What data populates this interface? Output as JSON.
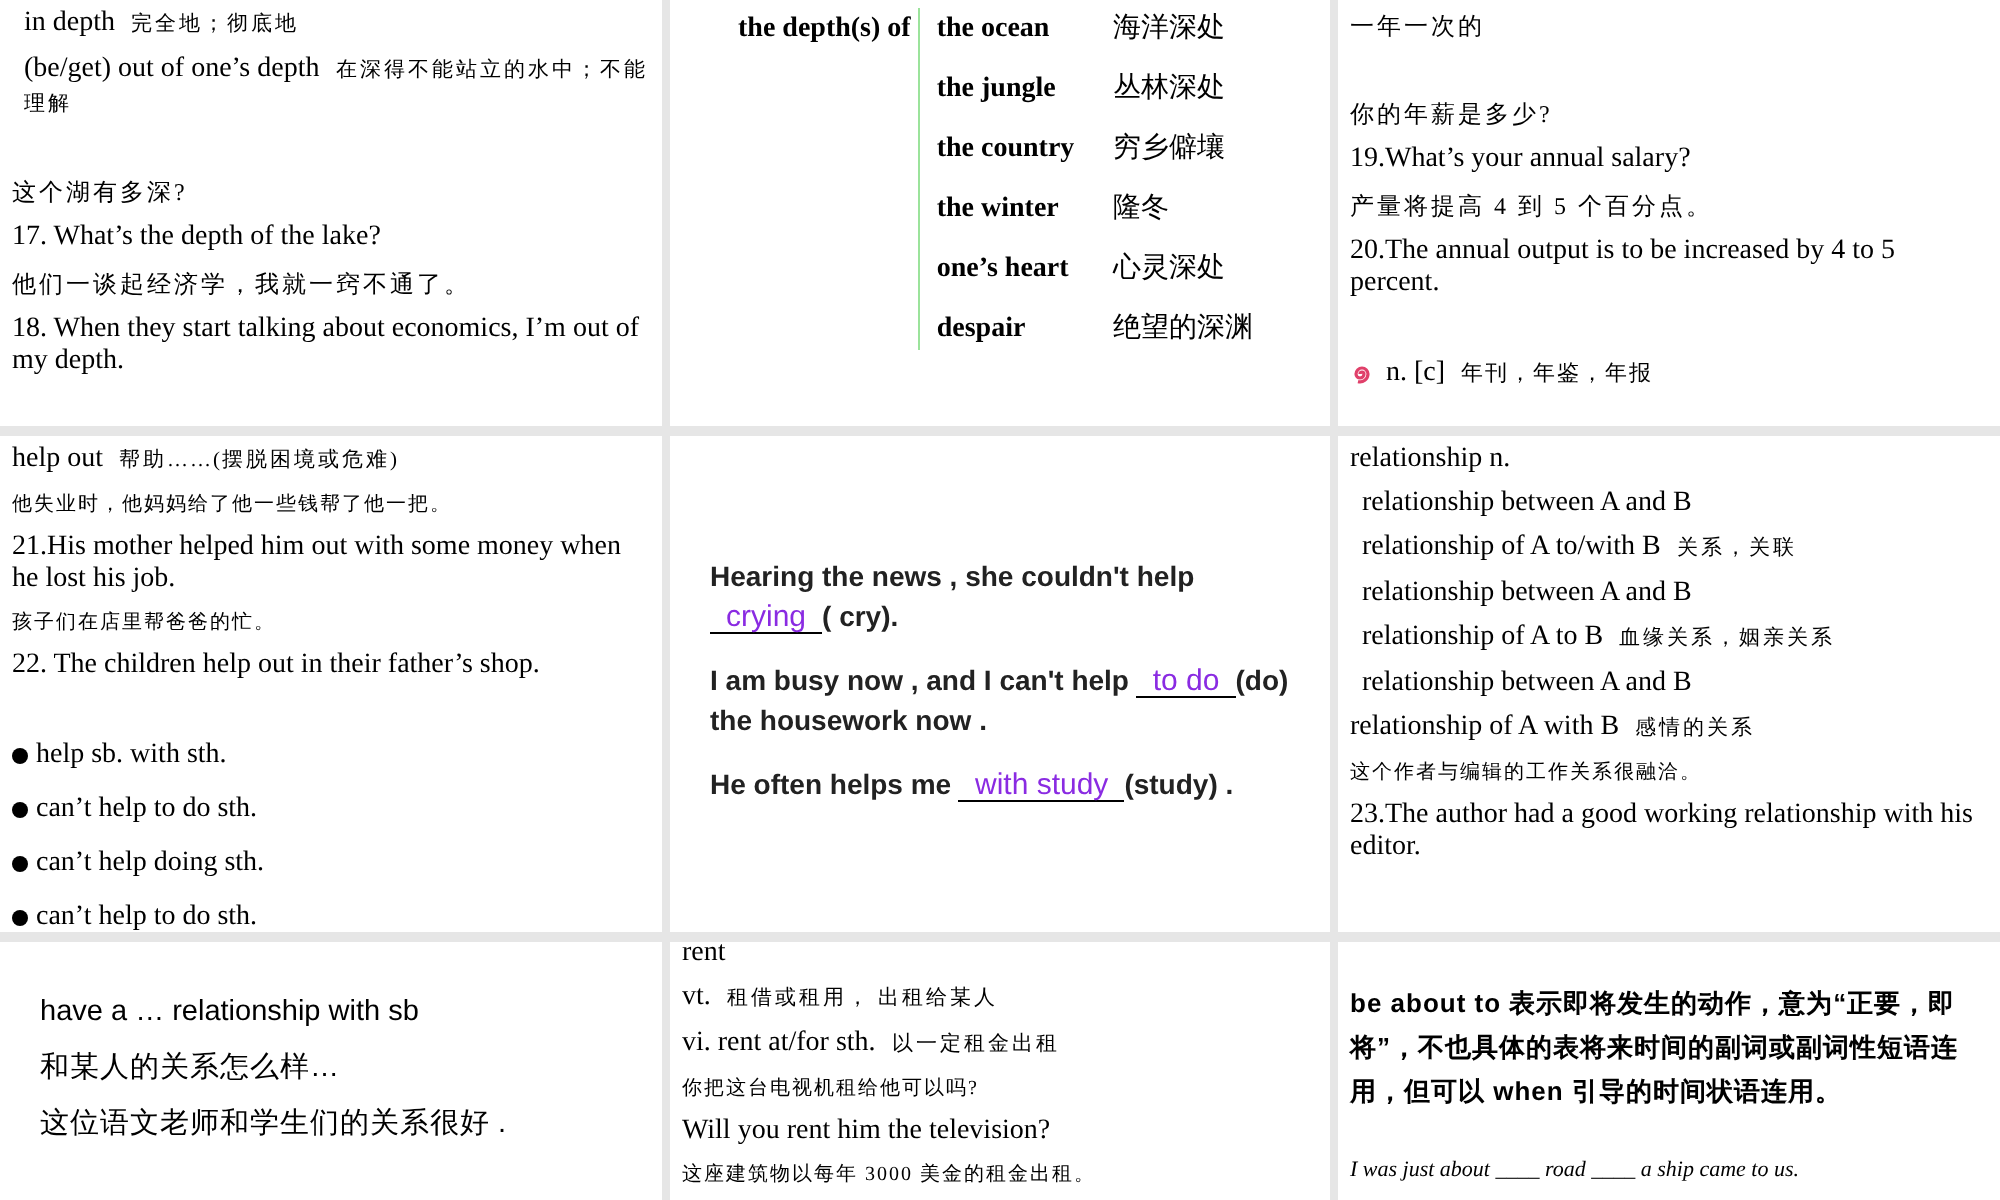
{
  "slides": [
    {
      "kind": "text",
      "lines": [
        {
          "kind": "en",
          "text": "in depth",
          "zh": "完全地；彻底地",
          "indent": true
        },
        {
          "kind": "en",
          "text": "(be/get) out of one’s depth",
          "zh": "在深得不能站立的水中；不能理解",
          "indent": true
        },
        {
          "kind": "zh",
          "text": "这个湖有多深?",
          "gap": true
        },
        {
          "kind": "en",
          "text": "17. What’s the depth of the lake?"
        },
        {
          "kind": "zh",
          "text": "他们一谈起经济学，我就一窍不通了。"
        },
        {
          "kind": "en",
          "text": "18. When they start talking about economics, I’m out of my depth."
        }
      ]
    },
    {
      "kind": "phrase_table",
      "head": "the depth(s) of",
      "rows": [
        {
          "en": "the ocean",
          "zh": "海洋深处"
        },
        {
          "en": "the jungle",
          "zh": "丛林深处"
        },
        {
          "en": "the country",
          "zh": "穷乡僻壤"
        },
        {
          "en": "the winter",
          "zh": "隆冬"
        },
        {
          "en": "one’s heart",
          "zh": "心灵深处"
        },
        {
          "en": "despair",
          "zh": "绝望的深渊"
        }
      ]
    },
    {
      "kind": "text",
      "lines": [
        {
          "kind": "zh",
          "text": "一年一次的"
        },
        {
          "kind": "zh",
          "text": "你的年薪是多少?",
          "gap": true
        },
        {
          "kind": "en",
          "text": "19.What’s your annual salary?"
        },
        {
          "kind": "zh",
          "text": "产量将提高 4 到 5 个百分点。"
        },
        {
          "kind": "en",
          "text": "20.The annual output is to be increased by 4 to 5 percent."
        },
        {
          "kind": "icon_en",
          "text": "n. [c]",
          "zh": "年刊，年鉴，年报",
          "gap": true
        }
      ]
    },
    {
      "kind": "text",
      "lines": [
        {
          "kind": "en",
          "text": "help out",
          "zh": "帮助……(摆脱困境或危难)"
        },
        {
          "kind": "zh_small",
          "text": "他失业时，他妈妈给了他一些钱帮了他一把。"
        },
        {
          "kind": "en",
          "text": "21.His mother helped him out with some money when he lost his job."
        },
        {
          "kind": "zh_small",
          "text": "孩子们在店里帮爸爸的忙。"
        },
        {
          "kind": "en",
          "text": "22. The children help out in their father’s shop."
        },
        {
          "kind": "bullet",
          "text": "help sb. with sth.",
          "gap": true
        },
        {
          "kind": "bullet",
          "text": "can’t help to do sth."
        },
        {
          "kind": "bullet",
          "text": "can’t help doing sth."
        },
        {
          "kind": "bullet",
          "text": "can’t help to do sth."
        }
      ]
    },
    {
      "kind": "exercise",
      "items": [
        {
          "before": "Hearing the news , she couldn't help",
          "answer": "crying",
          "after": "( cry)."
        },
        {
          "before": "I am busy now , and I can't help",
          "answer": "to do",
          "after": "(do) the housework now ."
        },
        {
          "before": "He often helps me",
          "answer": "with study",
          "after": "(study) ."
        }
      ]
    },
    {
      "kind": "text",
      "lines": [
        {
          "kind": "en",
          "text": "relationship  n."
        },
        {
          "kind": "en",
          "text": "relationship between A and B",
          "indent": true
        },
        {
          "kind": "en",
          "text": "relationship of A to/with B",
          "zh": "关系，关联",
          "indent": true
        },
        {
          "kind": "en",
          "text": "relationship between A and B",
          "indent": true
        },
        {
          "kind": "en",
          "text": "relationship of A to B",
          "zh": "血缘关系，姻亲关系",
          "indent": true
        },
        {
          "kind": "en",
          "text": "relationship between A and B",
          "indent": true
        },
        {
          "kind": "en",
          "text": "relationship of A with B",
          "zh": "感情的关系"
        },
        {
          "kind": "zh_small",
          "text": "这个作者与编辑的工作关系很融洽。"
        },
        {
          "kind": "en",
          "text": "23.The author had a good working relationship with his editor."
        }
      ]
    },
    {
      "kind": "text",
      "lines": [
        {
          "kind": "sans",
          "text": "have a … relationship with sb",
          "gap": true
        },
        {
          "kind": "sans",
          "text": "和某人的关系怎么样…"
        },
        {
          "kind": "sans",
          "text": "这位语文老师和学生们的关系很好 ."
        }
      ]
    },
    {
      "kind": "text",
      "lines": [
        {
          "kind": "en_top",
          "text": "rent"
        },
        {
          "kind": "en",
          "text": "vt.",
          "zh": "租借或租用， 出租给某人"
        },
        {
          "kind": "en",
          "text": "vi. rent at/for sth.",
          "zh": "以一定租金出租"
        },
        {
          "kind": "zh_small",
          "text": "你把这台电视机租给他可以吗?"
        },
        {
          "kind": "en",
          "text": "Will you rent him the television?"
        },
        {
          "kind": "zh_small",
          "text": "这座建筑物以每年 3000 美金的租金出租。"
        }
      ]
    },
    {
      "kind": "text",
      "lines": [
        {
          "kind": "sans_bold",
          "text": "be about to 表示即将发生的动作，意为“正要，即将”，不也具体的表将来时间的副词或副词性短语连用，但可以 when 引导的时间状语连用。",
          "gap": true
        },
        {
          "kind": "italic",
          "text": "I was just about ____ road ____ a ship came to us.",
          "gap": true
        }
      ]
    }
  ]
}
